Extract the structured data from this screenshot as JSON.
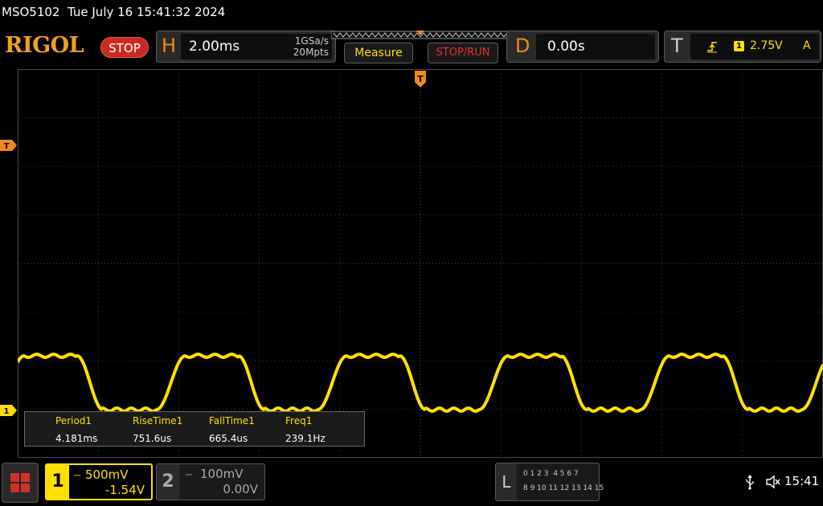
{
  "title": {
    "model": "MSO5102",
    "datetime": "Tue July 16 15:41:32 2024"
  },
  "header": {
    "brand": "RIGOL",
    "run_state": "STOP",
    "horizontal": {
      "letter": "H",
      "timebase": "2.00ms",
      "sample_rate": "1GSa/s",
      "memory_depth": "20Mpts"
    },
    "measure_label": "Measure",
    "stop_run_label": "STOP/RUN",
    "delay": {
      "letter": "D",
      "value": "0.00s"
    },
    "trigger": {
      "letter": "T",
      "edge_icon": "rising-edge-icon",
      "source": "1",
      "level": "2.75V",
      "mode": "A"
    }
  },
  "markers": {
    "trigger_position": "T",
    "trigger_level": "T",
    "channel1_ground": "1"
  },
  "measurements": [
    {
      "name": "Period1",
      "value": "4.181ms"
    },
    {
      "name": "RiseTime1",
      "value": "751.6us"
    },
    {
      "name": "FallTime1",
      "value": "665.4us"
    },
    {
      "name": "Freq1",
      "value": "239.1Hz"
    }
  ],
  "channels": {
    "ch1": {
      "number": "1",
      "scale": "500mV",
      "offset": "-1.54V",
      "color": "#ffe000",
      "active": true
    },
    "ch2": {
      "number": "2",
      "scale": "100mV",
      "offset": "0.00V",
      "color": "#aaaaaa",
      "active": false
    }
  },
  "logic_analyzer": {
    "letter": "L",
    "row1": "0 1 2 3  4 5 6 7",
    "row2": "8 9 10 11 12 13 14 15"
  },
  "status": {
    "usb_icon": "usb-icon",
    "sound_icon": "speaker-muted-icon",
    "time": "15:41"
  },
  "colors": {
    "ch1": "#ffe000",
    "accent_orange": "#f08a1c",
    "stop_red": "#c92b20"
  }
}
